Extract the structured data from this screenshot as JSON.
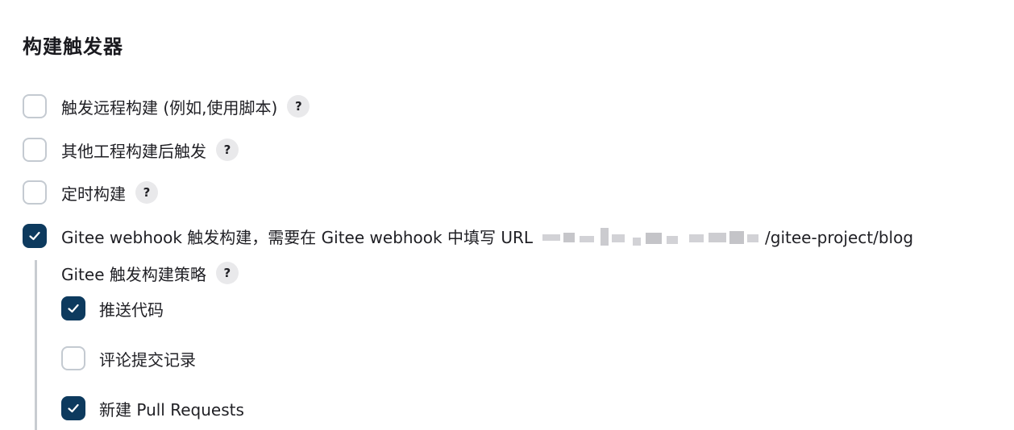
{
  "section": {
    "title": "构建触发器"
  },
  "triggers": [
    {
      "label": "触发远程构建 (例如,使用脚本)",
      "checked": false,
      "help": "?"
    },
    {
      "label": "其他工程构建后触发",
      "checked": false,
      "help": "?"
    },
    {
      "label": "定时构建",
      "checked": false,
      "help": "?"
    },
    {
      "label_prefix": "Gitee webhook 触发构建，需要在 Gitee webhook 中填写 URL",
      "label_suffix": "/gitee-project/blog",
      "checked": true
    }
  ],
  "gitee_strategy": {
    "title": "Gitee 触发构建策略",
    "help": "?",
    "options": [
      {
        "label": "推送代码",
        "checked": true
      },
      {
        "label": "评论提交记录",
        "checked": false
      },
      {
        "label": "新建 Pull Requests",
        "checked": true
      }
    ]
  },
  "colors": {
    "accent": "#0d3a5e",
    "checkbox_border": "#c4cad1",
    "help_bg": "#e9e9eb"
  }
}
